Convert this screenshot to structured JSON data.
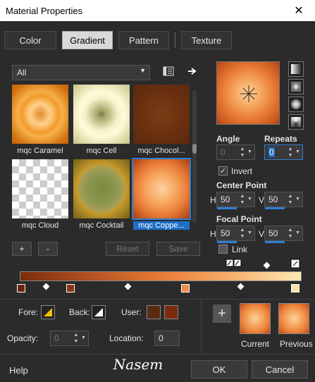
{
  "window": {
    "title": "Material Properties",
    "close_glyph": "✕"
  },
  "tabs": [
    {
      "label": "Color",
      "active": false
    },
    {
      "label": "Gradient",
      "active": true
    },
    {
      "label": "Pattern",
      "active": false
    },
    {
      "label": "Texture",
      "active": false
    }
  ],
  "filter": {
    "value": "All"
  },
  "gradients": [
    {
      "label": "mqc Caramel",
      "colors": [
        "#ffd08a",
        "#f39a2a",
        "#c2620a"
      ]
    },
    {
      "label": "mqc Cell",
      "colors": [
        "#7c7a3c",
        "#f3f2c9",
        "#c8c58c"
      ]
    },
    {
      "label": "mqc Chocol...",
      "colors": [
        "#7a3c14",
        "#6b3110",
        "#5c280c"
      ]
    },
    {
      "label": "mqc Cloud",
      "colors": [
        "#ffffff",
        "#d0d0d0"
      ]
    },
    {
      "label": "mqc Cocktail",
      "colors": [
        "#7c8a3a",
        "#a8a055",
        "#6e5f1a"
      ]
    },
    {
      "label": "mqc Coppe...",
      "colors": [
        "#fbd2a0",
        "#e87a34",
        "#a33f12"
      ],
      "selected": true
    }
  ],
  "list_buttons": {
    "add": "+",
    "remove": "-",
    "reset": "Reset",
    "save": "Save"
  },
  "angle": {
    "label": "Angle",
    "value": "0"
  },
  "repeats": {
    "label": "Repeats",
    "value": "0"
  },
  "invert": {
    "label": "Invert",
    "checked": true
  },
  "center_point": {
    "label": "Center Point",
    "h_label": "H",
    "h": "50",
    "v_label": "V",
    "v": "50"
  },
  "focal_point": {
    "label": "Focal Point",
    "h_label": "H",
    "h": "50",
    "v_label": "V",
    "v": "50"
  },
  "link": {
    "label": "Link",
    "checked": false
  },
  "gradient_editor": {
    "colors": [
      "#7a2c0c",
      "#a84a1c",
      "#e87a34",
      "#f7b06c",
      "#fde7b4"
    ],
    "stop_colors": [
      "#6b2608",
      "#8c3514",
      "#f08a44",
      "#fbe2a8"
    ]
  },
  "fore": {
    "label": "Fore:"
  },
  "back": {
    "label": "Back:"
  },
  "user": {
    "label": "User:",
    "colors": [
      "#5a2a10",
      "#7a2c0c"
    ]
  },
  "opacity": {
    "label": "Opacity:",
    "value": "0"
  },
  "location": {
    "label": "Location:",
    "value": "0"
  },
  "current": {
    "label": "Current"
  },
  "previous": {
    "label": "Previous"
  },
  "footer": {
    "help": "Help",
    "ok": "OK",
    "cancel": "Cancel"
  },
  "watermark": {
    "text": "Nasem"
  }
}
